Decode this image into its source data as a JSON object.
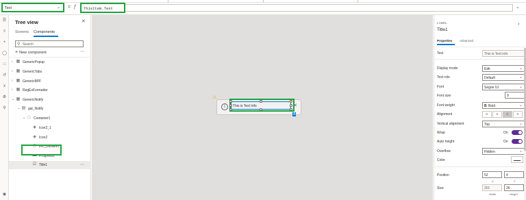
{
  "formula_bar": {
    "property": "Text",
    "equals": "=",
    "fx": "f",
    "formula": "ThisItem.Text"
  },
  "tree": {
    "title": "Tree view",
    "tabs": [
      "Screens",
      "Components"
    ],
    "search_placeholder": "Search",
    "new_component": "New component",
    "items": [
      {
        "label": "GenericPopup",
        "icon": "component-icon"
      },
      {
        "label": "GenericTabs",
        "icon": "component-icon"
      },
      {
        "label": "GenericBPF",
        "icon": "component-icon"
      },
      {
        "label": "RegExFormatter",
        "icon": "component-icon"
      },
      {
        "label": "GenericNotify",
        "icon": "component-icon"
      },
      {
        "label": "gal_Notify",
        "icon": "gallery-icon"
      },
      {
        "label": "Container1",
        "icon": "container-icon"
      },
      {
        "label": "Icon2_1",
        "icon": "icon-control-icon"
      },
      {
        "label": "Icon2",
        "icon": "icon-control-icon"
      },
      {
        "label": "tmr_Duration",
        "icon": "timer-icon"
      },
      {
        "label": "Progress1",
        "icon": "progress-icon"
      },
      {
        "label": "Title1",
        "icon": "label-icon"
      }
    ]
  },
  "canvas": {
    "label_text": "This is Text Info"
  },
  "props": {
    "type": "LABEL",
    "name": "Title1",
    "tabs": [
      "Properties",
      "Advanced"
    ],
    "text_label": "Text",
    "text_value": "This is Text info",
    "display_mode_label": "Display mode",
    "display_mode_value": "Edit",
    "text_role_label": "Text role",
    "text_role_value": "Default",
    "font_label": "Font",
    "font_value": "Segoe UI",
    "font_size_label": "Font size",
    "font_size_value": "9",
    "font_weight_label": "Font weight",
    "font_weight_value": "Bold",
    "alignment_label": "Alignment",
    "vertical_alignment_label": "Vertical alignment",
    "vertical_alignment_value": "Top",
    "wrap_label": "Wrap",
    "wrap_value": "On",
    "auto_height_label": "Auto height",
    "auto_height_value": "On",
    "overflow_label": "Overflow",
    "overflow_value": "Hidden",
    "color_label": "Color",
    "position_label": "Position",
    "position_x": "52",
    "position_y": "4",
    "x_label": "X",
    "y_label": "Y",
    "size_label": "Size",
    "size_width": "201",
    "size_height": "26",
    "width_label": "Width",
    "height_label": "Height"
  },
  "colors": {
    "highlight": "#1aa33b",
    "accent": "#0078d4",
    "toggle": "#5c2d91"
  }
}
